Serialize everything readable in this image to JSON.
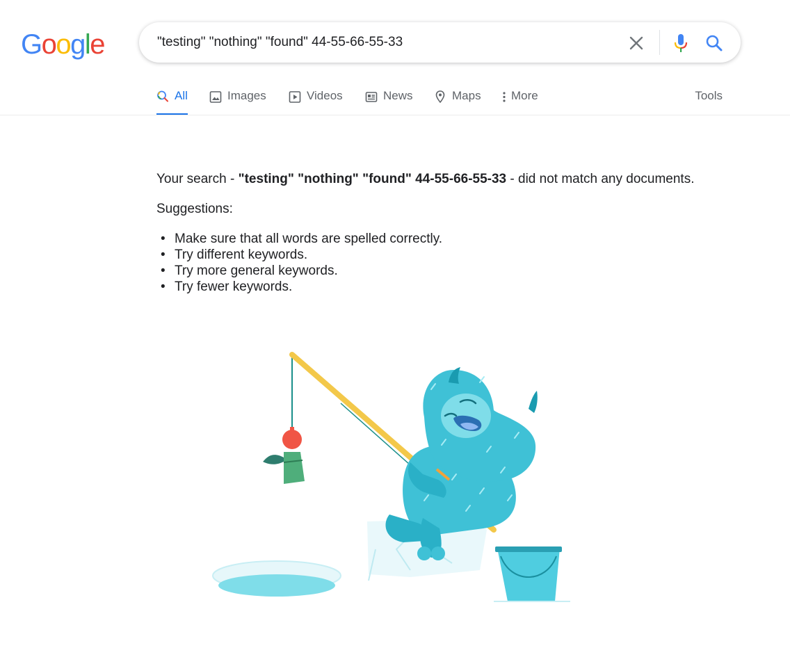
{
  "logo": {
    "letters": [
      "G",
      "o",
      "o",
      "g",
      "l",
      "e"
    ]
  },
  "search": {
    "value": "\"testing\" \"nothing\" \"found\" 44-55-66-55-33",
    "clear_icon": "close-icon",
    "mic_icon": "microphone-icon",
    "search_icon": "search-icon"
  },
  "tabs": [
    {
      "label": "All",
      "icon": "search-icon",
      "active": true
    },
    {
      "label": "Images",
      "icon": "image-icon",
      "active": false
    },
    {
      "label": "Videos",
      "icon": "play-icon",
      "active": false
    },
    {
      "label": "News",
      "icon": "news-icon",
      "active": false
    },
    {
      "label": "Maps",
      "icon": "map-pin-icon",
      "active": false
    },
    {
      "label": "More",
      "icon": "more-vert-icon",
      "active": false
    }
  ],
  "tools_label": "Tools",
  "result": {
    "prefix": "Your search - ",
    "query": "\"testing\" \"nothing\" \"found\" 44-55-66-55-33",
    "suffix": " - did not match any documents.",
    "suggestions_label": "Suggestions:",
    "suggestions": [
      "Make sure that all words are spelled correctly.",
      "Try different keywords.",
      "Try more general keywords.",
      "Try fewer keywords."
    ]
  },
  "illustration": {
    "subject": "yeti-fishing-illustration"
  },
  "colors": {
    "blue": "#4285f4",
    "red": "#ea4335",
    "yellow": "#fbbc05",
    "green": "#34a853",
    "active_tab": "#1a73e8",
    "yeti": "#3fc1d6"
  }
}
